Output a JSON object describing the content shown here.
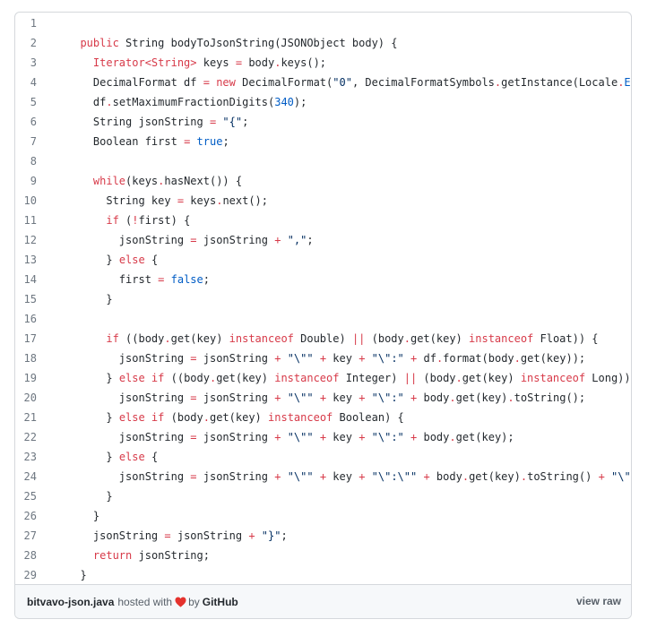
{
  "code": {
    "lines": [
      {
        "n": "1",
        "tokens": []
      },
      {
        "n": "2",
        "tokens": [
          [
            "ind",
            "  "
          ],
          [
            "kw",
            "public"
          ],
          [
            "t",
            " String bodyToJsonString(JSONObject body) {"
          ]
        ]
      },
      {
        "n": "3",
        "tokens": [
          [
            "ind",
            "    "
          ],
          [
            "kw",
            "Iterator<String>"
          ],
          [
            "t",
            " keys "
          ],
          [
            "op",
            "="
          ],
          [
            "t",
            " body"
          ],
          [
            "op",
            "."
          ],
          [
            "t",
            "keys();"
          ]
        ]
      },
      {
        "n": "4",
        "tokens": [
          [
            "ind",
            "    "
          ],
          [
            "t",
            "DecimalFormat df "
          ],
          [
            "op",
            "="
          ],
          [
            "t",
            " "
          ],
          [
            "kw",
            "new"
          ],
          [
            "t",
            " DecimalFormat("
          ],
          [
            "str",
            "\"0\""
          ],
          [
            "t",
            ", DecimalFormatSymbols"
          ],
          [
            "op",
            "."
          ],
          [
            "t",
            "getInstance(Locale"
          ],
          [
            "op",
            "."
          ],
          [
            "con",
            "ENGLISH"
          ],
          [
            "t",
            "));"
          ]
        ]
      },
      {
        "n": "5",
        "tokens": [
          [
            "ind",
            "    "
          ],
          [
            "t",
            "df"
          ],
          [
            "op",
            "."
          ],
          [
            "t",
            "setMaximumFractionDigits("
          ],
          [
            "num",
            "340"
          ],
          [
            "t",
            ");"
          ]
        ]
      },
      {
        "n": "6",
        "tokens": [
          [
            "ind",
            "    "
          ],
          [
            "t",
            "String jsonString "
          ],
          [
            "op",
            "="
          ],
          [
            "t",
            " "
          ],
          [
            "str",
            "\"{\""
          ],
          [
            "t",
            ";"
          ]
        ]
      },
      {
        "n": "7",
        "tokens": [
          [
            "ind",
            "    "
          ],
          [
            "t",
            "Boolean first "
          ],
          [
            "op",
            "="
          ],
          [
            "t",
            " "
          ],
          [
            "con",
            "true"
          ],
          [
            "t",
            ";"
          ]
        ]
      },
      {
        "n": "8",
        "tokens": []
      },
      {
        "n": "9",
        "tokens": [
          [
            "ind",
            "    "
          ],
          [
            "kw",
            "while"
          ],
          [
            "t",
            "(keys"
          ],
          [
            "op",
            "."
          ],
          [
            "t",
            "hasNext()) {"
          ]
        ]
      },
      {
        "n": "10",
        "tokens": [
          [
            "ind",
            "      "
          ],
          [
            "t",
            "String key "
          ],
          [
            "op",
            "="
          ],
          [
            "t",
            " keys"
          ],
          [
            "op",
            "."
          ],
          [
            "t",
            "next();"
          ]
        ]
      },
      {
        "n": "11",
        "tokens": [
          [
            "ind",
            "      "
          ],
          [
            "kw",
            "if"
          ],
          [
            "t",
            " ("
          ],
          [
            "op",
            "!"
          ],
          [
            "t",
            "first) {"
          ]
        ]
      },
      {
        "n": "12",
        "tokens": [
          [
            "ind",
            "        "
          ],
          [
            "t",
            "jsonString "
          ],
          [
            "op",
            "="
          ],
          [
            "t",
            " jsonString "
          ],
          [
            "op",
            "+"
          ],
          [
            "t",
            " "
          ],
          [
            "str",
            "\",\""
          ],
          [
            "t",
            ";"
          ]
        ]
      },
      {
        "n": "13",
        "tokens": [
          [
            "ind",
            "      "
          ],
          [
            "t",
            "} "
          ],
          [
            "kw",
            "else"
          ],
          [
            "t",
            " {"
          ]
        ]
      },
      {
        "n": "14",
        "tokens": [
          [
            "ind",
            "        "
          ],
          [
            "t",
            "first "
          ],
          [
            "op",
            "="
          ],
          [
            "t",
            " "
          ],
          [
            "con",
            "false"
          ],
          [
            "t",
            ";"
          ]
        ]
      },
      {
        "n": "15",
        "tokens": [
          [
            "ind",
            "      "
          ],
          [
            "t",
            "}"
          ]
        ]
      },
      {
        "n": "16",
        "tokens": []
      },
      {
        "n": "17",
        "tokens": [
          [
            "ind",
            "      "
          ],
          [
            "kw",
            "if"
          ],
          [
            "t",
            " ((body"
          ],
          [
            "op",
            "."
          ],
          [
            "t",
            "get(key) "
          ],
          [
            "kw",
            "instanceof"
          ],
          [
            "t",
            " Double) "
          ],
          [
            "op",
            "||"
          ],
          [
            "t",
            " (body"
          ],
          [
            "op",
            "."
          ],
          [
            "t",
            "get(key) "
          ],
          [
            "kw",
            "instanceof"
          ],
          [
            "t",
            " Float)) {"
          ]
        ]
      },
      {
        "n": "18",
        "tokens": [
          [
            "ind",
            "        "
          ],
          [
            "t",
            "jsonString "
          ],
          [
            "op",
            "="
          ],
          [
            "t",
            " jsonString "
          ],
          [
            "op",
            "+"
          ],
          [
            "t",
            " "
          ],
          [
            "str",
            "\"\\\"\""
          ],
          [
            "t",
            " "
          ],
          [
            "op",
            "+"
          ],
          [
            "t",
            " key "
          ],
          [
            "op",
            "+"
          ],
          [
            "t",
            " "
          ],
          [
            "str",
            "\"\\\":\""
          ],
          [
            "t",
            " "
          ],
          [
            "op",
            "+"
          ],
          [
            "t",
            " df"
          ],
          [
            "op",
            "."
          ],
          [
            "t",
            "format(body"
          ],
          [
            "op",
            "."
          ],
          [
            "t",
            "get(key));"
          ]
        ]
      },
      {
        "n": "19",
        "tokens": [
          [
            "ind",
            "      "
          ],
          [
            "t",
            "} "
          ],
          [
            "kw",
            "else if"
          ],
          [
            "t",
            " ((body"
          ],
          [
            "op",
            "."
          ],
          [
            "t",
            "get(key) "
          ],
          [
            "kw",
            "instanceof"
          ],
          [
            "t",
            " Integer) "
          ],
          [
            "op",
            "||"
          ],
          [
            "t",
            " (body"
          ],
          [
            "op",
            "."
          ],
          [
            "t",
            "get(key) "
          ],
          [
            "kw",
            "instanceof"
          ],
          [
            "t",
            " Long)) {"
          ]
        ]
      },
      {
        "n": "20",
        "tokens": [
          [
            "ind",
            "        "
          ],
          [
            "t",
            "jsonString "
          ],
          [
            "op",
            "="
          ],
          [
            "t",
            " jsonString "
          ],
          [
            "op",
            "+"
          ],
          [
            "t",
            " "
          ],
          [
            "str",
            "\"\\\"\""
          ],
          [
            "t",
            " "
          ],
          [
            "op",
            "+"
          ],
          [
            "t",
            " key "
          ],
          [
            "op",
            "+"
          ],
          [
            "t",
            " "
          ],
          [
            "str",
            "\"\\\":\""
          ],
          [
            "t",
            " "
          ],
          [
            "op",
            "+"
          ],
          [
            "t",
            " body"
          ],
          [
            "op",
            "."
          ],
          [
            "t",
            "get(key)"
          ],
          [
            "op",
            "."
          ],
          [
            "t",
            "toString();"
          ]
        ]
      },
      {
        "n": "21",
        "tokens": [
          [
            "ind",
            "      "
          ],
          [
            "t",
            "} "
          ],
          [
            "kw",
            "else if"
          ],
          [
            "t",
            " (body"
          ],
          [
            "op",
            "."
          ],
          [
            "t",
            "get(key) "
          ],
          [
            "kw",
            "instanceof"
          ],
          [
            "t",
            " Boolean) {"
          ]
        ]
      },
      {
        "n": "22",
        "tokens": [
          [
            "ind",
            "        "
          ],
          [
            "t",
            "jsonString "
          ],
          [
            "op",
            "="
          ],
          [
            "t",
            " jsonString "
          ],
          [
            "op",
            "+"
          ],
          [
            "t",
            " "
          ],
          [
            "str",
            "\"\\\"\""
          ],
          [
            "t",
            " "
          ],
          [
            "op",
            "+"
          ],
          [
            "t",
            " key "
          ],
          [
            "op",
            "+"
          ],
          [
            "t",
            " "
          ],
          [
            "str",
            "\"\\\":\""
          ],
          [
            "t",
            " "
          ],
          [
            "op",
            "+"
          ],
          [
            "t",
            " body"
          ],
          [
            "op",
            "."
          ],
          [
            "t",
            "get(key);"
          ]
        ]
      },
      {
        "n": "23",
        "tokens": [
          [
            "ind",
            "      "
          ],
          [
            "t",
            "} "
          ],
          [
            "kw",
            "else"
          ],
          [
            "t",
            " {"
          ]
        ]
      },
      {
        "n": "24",
        "tokens": [
          [
            "ind",
            "        "
          ],
          [
            "t",
            "jsonString "
          ],
          [
            "op",
            "="
          ],
          [
            "t",
            " jsonString "
          ],
          [
            "op",
            "+"
          ],
          [
            "t",
            " "
          ],
          [
            "str",
            "\"\\\"\""
          ],
          [
            "t",
            " "
          ],
          [
            "op",
            "+"
          ],
          [
            "t",
            " key "
          ],
          [
            "op",
            "+"
          ],
          [
            "t",
            " "
          ],
          [
            "str",
            "\"\\\":\\\"\""
          ],
          [
            "t",
            " "
          ],
          [
            "op",
            "+"
          ],
          [
            "t",
            " body"
          ],
          [
            "op",
            "."
          ],
          [
            "t",
            "get(key)"
          ],
          [
            "op",
            "."
          ],
          [
            "t",
            "toString() "
          ],
          [
            "op",
            "+"
          ],
          [
            "t",
            " "
          ],
          [
            "str",
            "\"\\\"\""
          ],
          [
            "t",
            ";"
          ]
        ]
      },
      {
        "n": "25",
        "tokens": [
          [
            "ind",
            "      "
          ],
          [
            "t",
            "}"
          ]
        ]
      },
      {
        "n": "26",
        "tokens": [
          [
            "ind",
            "    "
          ],
          [
            "t",
            "}"
          ]
        ]
      },
      {
        "n": "27",
        "tokens": [
          [
            "ind",
            "    "
          ],
          [
            "t",
            "jsonString "
          ],
          [
            "op",
            "="
          ],
          [
            "t",
            " jsonString "
          ],
          [
            "op",
            "+"
          ],
          [
            "t",
            " "
          ],
          [
            "str",
            "\"}\""
          ],
          [
            "t",
            ";"
          ]
        ]
      },
      {
        "n": "28",
        "tokens": [
          [
            "ind",
            "    "
          ],
          [
            "kw",
            "return"
          ],
          [
            "t",
            " jsonString;"
          ]
        ]
      },
      {
        "n": "29",
        "tokens": [
          [
            "ind",
            "  "
          ],
          [
            "t",
            "}"
          ]
        ]
      }
    ]
  },
  "footer": {
    "filename": "bitvavo-json.java",
    "hosted_with": "hosted with",
    "by": "by",
    "github": "GitHub",
    "view_raw": "view raw",
    "heart_color": "#e5322d"
  }
}
